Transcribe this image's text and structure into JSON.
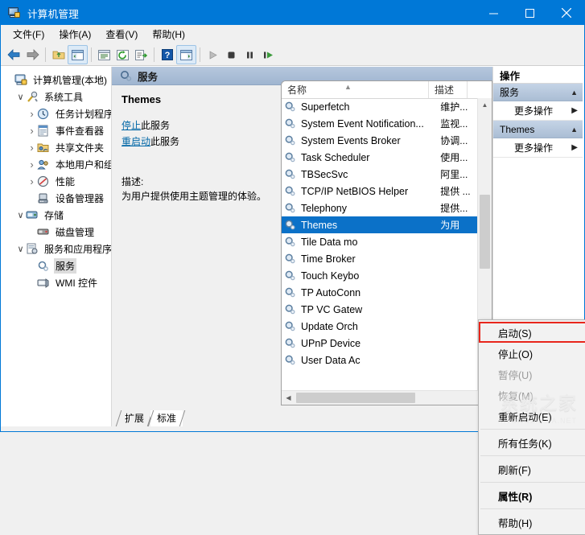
{
  "window": {
    "title": "计算机管理",
    "icon": "computer-management-icon",
    "controls": {
      "minimize": "最小化",
      "maximize": "最大化",
      "close": "关闭"
    }
  },
  "menubar": [
    {
      "label": "文件(F)",
      "name": "menu-file"
    },
    {
      "label": "操作(A)",
      "name": "menu-action"
    },
    {
      "label": "查看(V)",
      "name": "menu-view"
    },
    {
      "label": "帮助(H)",
      "name": "menu-help"
    }
  ],
  "toolbar": [
    {
      "name": "back-icon"
    },
    {
      "name": "forward-icon"
    },
    {
      "name": "up-folder-icon"
    },
    {
      "name": "show-console-tree-icon"
    },
    {
      "name": "properties-icon"
    },
    {
      "name": "refresh-icon"
    },
    {
      "name": "export-list-icon"
    },
    {
      "name": "help-icon"
    },
    {
      "name": "show-action-pane-icon"
    },
    {
      "name": "start-service-icon"
    },
    {
      "name": "stop-service-icon"
    },
    {
      "name": "pause-service-icon"
    },
    {
      "name": "restart-service-icon"
    }
  ],
  "tree": [
    {
      "label": "计算机管理(本地)",
      "indent": 0,
      "expander": "none",
      "icon": "computer-icon",
      "selected": false
    },
    {
      "label": "系统工具",
      "indent": 1,
      "expander": "down",
      "icon": "tools-icon",
      "selected": false
    },
    {
      "label": "任务计划程序",
      "indent": 2,
      "expander": "right",
      "icon": "clock-icon",
      "selected": false
    },
    {
      "label": "事件查看器",
      "indent": 2,
      "expander": "right",
      "icon": "event-viewer-icon",
      "selected": false
    },
    {
      "label": "共享文件夹",
      "indent": 2,
      "expander": "right",
      "icon": "shared-folder-icon",
      "selected": false
    },
    {
      "label": "本地用户和组",
      "indent": 2,
      "expander": "right",
      "icon": "users-icon",
      "selected": false
    },
    {
      "label": "性能",
      "indent": 2,
      "expander": "right",
      "icon": "performance-icon",
      "selected": false
    },
    {
      "label": "设备管理器",
      "indent": 2,
      "expander": "none",
      "icon": "device-manager-icon",
      "selected": false
    },
    {
      "label": "存储",
      "indent": 1,
      "expander": "down",
      "icon": "storage-icon",
      "selected": false
    },
    {
      "label": "磁盘管理",
      "indent": 2,
      "expander": "none",
      "icon": "disk-management-icon",
      "selected": false
    },
    {
      "label": "服务和应用程序",
      "indent": 1,
      "expander": "down",
      "icon": "services-apps-icon",
      "selected": false
    },
    {
      "label": "服务",
      "indent": 2,
      "expander": "none",
      "icon": "services-icon",
      "selected": true
    },
    {
      "label": "WMI 控件",
      "indent": 2,
      "expander": "none",
      "icon": "wmi-icon",
      "selected": false
    }
  ],
  "mid": {
    "header": "服务",
    "service_name": "Themes",
    "links": [
      {
        "link": "停止",
        "rest": "此服务",
        "name": "stop-service-link"
      },
      {
        "link": "重启动",
        "rest": "此服务",
        "name": "restart-service-link"
      }
    ],
    "description_label": "描述:",
    "description_text": "为用户提供使用主题管理的体验。",
    "tabs": [
      {
        "label": "扩展",
        "active": false
      },
      {
        "label": "标准",
        "active": true
      }
    ]
  },
  "list": {
    "columns": [
      {
        "label": "名称",
        "sorted": "asc"
      },
      {
        "label": "描述",
        "sorted": "none"
      }
    ],
    "rows": [
      {
        "name": "Superfetch",
        "desc": "维护..."
      },
      {
        "name": "System Event Notification...",
        "desc": "监视..."
      },
      {
        "name": "System Events Broker",
        "desc": "协调..."
      },
      {
        "name": "Task Scheduler",
        "desc": "使用..."
      },
      {
        "name": "TBSecSvc",
        "desc": "阿里..."
      },
      {
        "name": "TCP/IP NetBIOS Helper",
        "desc": "提供 ..."
      },
      {
        "name": "Telephony",
        "desc": "提供..."
      },
      {
        "name": "Themes",
        "desc": "为用",
        "selected": true
      },
      {
        "name": "Tile Data mo",
        "desc": ""
      },
      {
        "name": "Time Broker",
        "desc": ""
      },
      {
        "name": "Touch Keybo",
        "desc": ""
      },
      {
        "name": "TP AutoConn",
        "desc": ""
      },
      {
        "name": "TP VC Gatew",
        "desc": ""
      },
      {
        "name": "Update Orch",
        "desc": ""
      },
      {
        "name": "UPnP Device",
        "desc": ""
      },
      {
        "name": "User Data Ac",
        "desc": ""
      }
    ]
  },
  "context_menu": [
    {
      "label": "启动(S)",
      "state": "highlighted",
      "name": "ctx-start"
    },
    {
      "label": "停止(O)",
      "state": "normal",
      "name": "ctx-stop"
    },
    {
      "label": "暂停(U)",
      "state": "disabled",
      "name": "ctx-pause"
    },
    {
      "label": "恢复(M)",
      "state": "disabled",
      "name": "ctx-resume"
    },
    {
      "label": "重新启动(E)",
      "state": "normal",
      "name": "ctx-restart"
    },
    {
      "separator": true
    },
    {
      "label": "所有任务(K)",
      "state": "submenu",
      "name": "ctx-all-tasks"
    },
    {
      "separator": true
    },
    {
      "label": "刷新(F)",
      "state": "normal",
      "name": "ctx-refresh"
    },
    {
      "separator": true
    },
    {
      "label": "属性(R)",
      "state": "bold",
      "name": "ctx-properties"
    },
    {
      "separator": true
    },
    {
      "label": "帮助(H)",
      "state": "normal",
      "name": "ctx-help"
    }
  ],
  "actions": {
    "title": "操作",
    "groups": [
      {
        "name": "服务",
        "items": [
          {
            "label": "更多操作"
          }
        ]
      },
      {
        "name": "Themes",
        "items": [
          {
            "label": "更多操作"
          }
        ]
      }
    ]
  },
  "watermark": {
    "text": "系统之家",
    "sub": "XITONGZHIJIA.NET"
  },
  "colors": {
    "titlebar": "#0078d7",
    "selection": "#0b71c8",
    "highlight_box": "#e8261c",
    "link": "#0066a6",
    "header_gradient_top": "#b6c7dd"
  }
}
